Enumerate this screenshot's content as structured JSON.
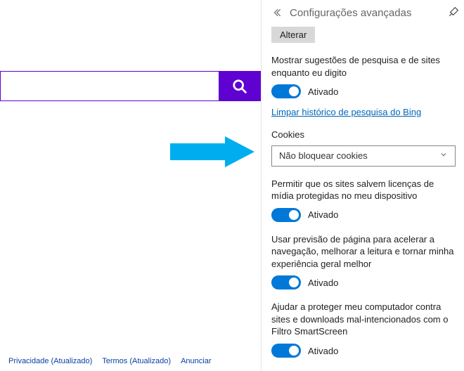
{
  "search": {
    "placeholder": ""
  },
  "footer": {
    "privacy": "Privacidade (Atualizado)",
    "terms": "Termos (Atualizado)",
    "advertise": "Anunciar"
  },
  "panel": {
    "title": "Configurações avançadas",
    "alter": "Alterar",
    "suggestions": {
      "label": "Mostrar sugestões de pesquisa e de sites enquanto eu digito",
      "state": "Ativado"
    },
    "clear_history": "Limpar histórico de pesquisa do Bing",
    "cookies": {
      "label": "Cookies",
      "selected": "Não bloquear cookies"
    },
    "media_licenses": {
      "label": "Permitir que os sites salvem licenças de mídia protegidas no meu dispositivo",
      "state": "Ativado"
    },
    "page_prediction": {
      "label": "Usar previsão de página para acelerar a navegação, melhorar a leitura e tornar minha experiência geral melhor",
      "state": "Ativado"
    },
    "smartscreen": {
      "label": "Ajudar a proteger meu computador contra sites e downloads mal-intencionados com o Filtro SmartScreen",
      "state": "Ativado"
    }
  }
}
